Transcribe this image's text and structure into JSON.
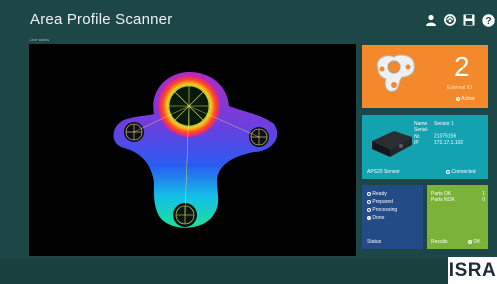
{
  "app": {
    "title": "Area Profile Scanner",
    "status_line": "Live status"
  },
  "toolbar": {
    "icons": [
      "user-icon",
      "refresh-icon",
      "save-icon",
      "help-icon"
    ]
  },
  "external_io": {
    "value": "2",
    "label": "External IO",
    "state": "Active"
  },
  "sensor": {
    "name_label": "Name",
    "name_value": "Sensor 1",
    "serial_label": "Serial-Nr.",
    "serial_value": "21375156",
    "ip_label": "IP",
    "ip_value": "172.17.1.102",
    "title": "APS20 Sensor",
    "state": "Connected"
  },
  "status": {
    "items": [
      {
        "label": "Ready",
        "active": false
      },
      {
        "label": "Prepared",
        "active": false
      },
      {
        "label": "Processing",
        "active": false
      },
      {
        "label": "Done",
        "active": true
      }
    ],
    "title": "Status"
  },
  "results": {
    "parts_ok_label": "Parts OK",
    "parts_ok_value": "1",
    "parts_nok_label": "Parts NOK",
    "parts_nok_value": "0",
    "title": "Results",
    "state": "OK"
  },
  "brand": {
    "logo": "ISRA"
  },
  "colors": {
    "background": "#1d4746",
    "external_tile": "#f3892a",
    "sensor_tile": "#13a3b0",
    "status_tile": "#234b85",
    "results_tile": "#7bb23a"
  }
}
